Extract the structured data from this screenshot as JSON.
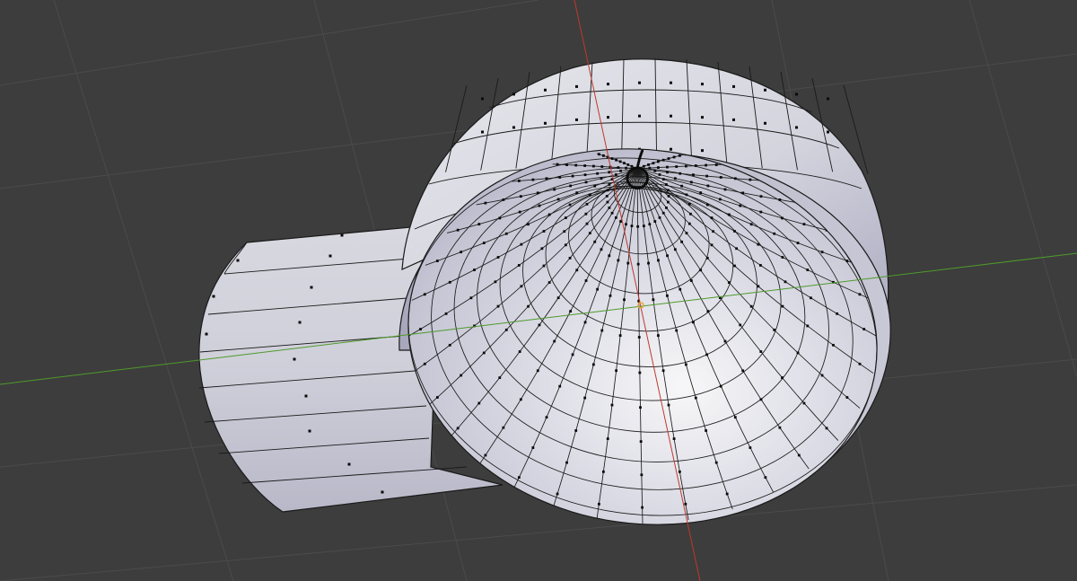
{
  "viewport": {
    "background_color": "#3d3d3d",
    "grid_color": "#4b4b4b",
    "x_axis_color": "#c0392b",
    "y_axis_color": "#4e9a2a",
    "origin_icon": "object-origin-icon"
  },
  "mesh": {
    "face_color": "#d9d9e3",
    "face_shade_color": "#a7a7bd",
    "inner_highlight_color": "#f4f4f6",
    "edge_color": "#1a1a1a",
    "vertex_color": "#0a0a0a",
    "objects": [
      {
        "name": "hemisphere-bowl",
        "icon": "hemisphere-mesh-icon"
      },
      {
        "name": "cylinder-section",
        "icon": "cylinder-mesh-icon"
      }
    ]
  }
}
